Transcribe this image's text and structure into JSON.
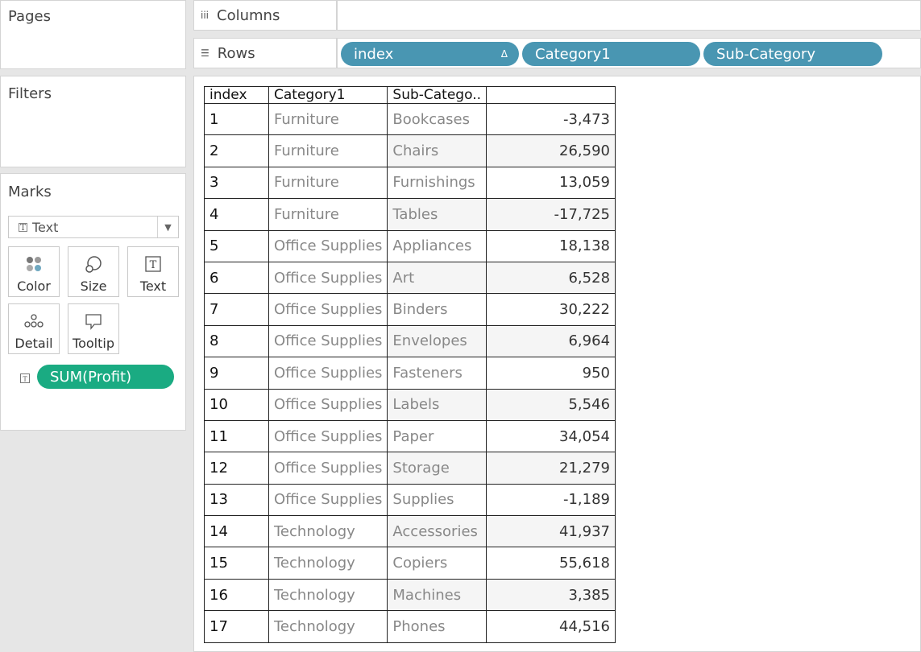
{
  "pages": {
    "title": "Pages"
  },
  "filters": {
    "title": "Filters"
  },
  "marks": {
    "title": "Marks",
    "mark_type": "Text",
    "buttons": {
      "color": "Color",
      "size": "Size",
      "text": "Text",
      "detail": "Detail",
      "tooltip": "Tooltip"
    },
    "fields": [
      {
        "label": "SUM(Profit)",
        "encoding": "text-icon",
        "color": "#1aab82"
      }
    ]
  },
  "shelves": {
    "columns": {
      "label": "Columns",
      "pills": []
    },
    "rows": {
      "label": "Rows",
      "pills": [
        "index",
        "Category1",
        "Sub-Category"
      ],
      "index_delta": "Δ"
    }
  },
  "colors": {
    "dimension_pill": "#4996b2",
    "measure_pill": "#1aab82"
  },
  "table": {
    "headers": [
      "index",
      "Category1",
      "Sub-Catego..",
      ""
    ],
    "rows": [
      {
        "index": "1",
        "category": "Furniture",
        "sub": "Bookcases",
        "value": "-3,473"
      },
      {
        "index": "2",
        "category": "Furniture",
        "sub": "Chairs",
        "value": "26,590"
      },
      {
        "index": "3",
        "category": "Furniture",
        "sub": "Furnishings",
        "value": "13,059"
      },
      {
        "index": "4",
        "category": "Furniture",
        "sub": "Tables",
        "value": "-17,725"
      },
      {
        "index": "5",
        "category": "Office Supplies",
        "sub": "Appliances",
        "value": "18,138"
      },
      {
        "index": "6",
        "category": "Office Supplies",
        "sub": "Art",
        "value": "6,528"
      },
      {
        "index": "7",
        "category": "Office Supplies",
        "sub": "Binders",
        "value": "30,222"
      },
      {
        "index": "8",
        "category": "Office Supplies",
        "sub": "Envelopes",
        "value": "6,964"
      },
      {
        "index": "9",
        "category": "Office Supplies",
        "sub": "Fasteners",
        "value": "950"
      },
      {
        "index": "10",
        "category": "Office Supplies",
        "sub": "Labels",
        "value": "5,546"
      },
      {
        "index": "11",
        "category": "Office Supplies",
        "sub": "Paper",
        "value": "34,054"
      },
      {
        "index": "12",
        "category": "Office Supplies",
        "sub": "Storage",
        "value": "21,279"
      },
      {
        "index": "13",
        "category": "Office Supplies",
        "sub": "Supplies",
        "value": "-1,189"
      },
      {
        "index": "14",
        "category": "Technology",
        "sub": "Accessories",
        "value": "41,937"
      },
      {
        "index": "15",
        "category": "Technology",
        "sub": "Copiers",
        "value": "55,618"
      },
      {
        "index": "16",
        "category": "Technology",
        "sub": "Machines",
        "value": "3,385"
      },
      {
        "index": "17",
        "category": "Technology",
        "sub": "Phones",
        "value": "44,516"
      }
    ]
  }
}
